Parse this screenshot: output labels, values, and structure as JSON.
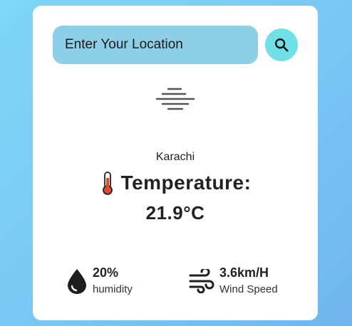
{
  "search": {
    "placeholder": "Enter Your Location"
  },
  "weather": {
    "condition_icon": "mist-icon",
    "city": "Karachi",
    "temperature_label": "Temperature:",
    "temperature_value": "21.9°C"
  },
  "details": {
    "humidity": {
      "value": "20%",
      "label": "humidity",
      "icon": "water-drop-icon"
    },
    "wind": {
      "value": "3.6km/H",
      "label": "Wind Speed",
      "icon": "wind-icon"
    }
  },
  "colors": {
    "background_start": "#7fd6f6",
    "background_end": "#6fb6f0",
    "input_background": "#8ccfe6",
    "search_button": "#6fe0e8",
    "card": "#ffffff"
  }
}
